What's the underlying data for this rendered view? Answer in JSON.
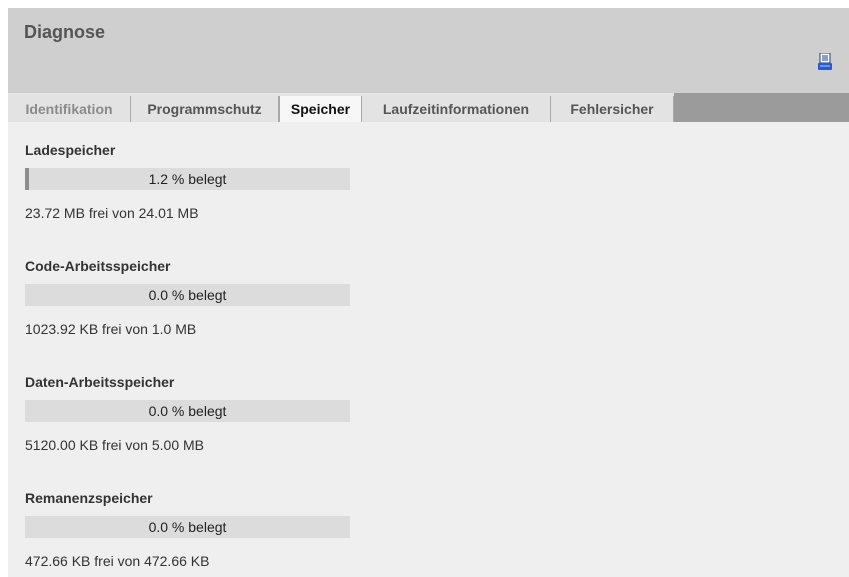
{
  "header": {
    "title": "Diagnose",
    "print_icon": "print-icon"
  },
  "tabs": [
    {
      "label": "Identifikation",
      "active": false
    },
    {
      "label": "Programmschutz",
      "active": false
    },
    {
      "label": "Speicher",
      "active": true
    },
    {
      "label": "Laufzeitinformationen",
      "active": false
    },
    {
      "label": "Fehlersicher",
      "active": false
    }
  ],
  "memory": [
    {
      "name": "Ladespeicher",
      "usage_percent": 1.2,
      "usage_text": "1.2 % belegt",
      "free_text": "23.72 MB frei von 24.01 MB"
    },
    {
      "name": "Code-Arbeitsspeicher",
      "usage_percent": 0.0,
      "usage_text": "0.0 % belegt",
      "free_text": "1023.92 KB frei von 1.0 MB"
    },
    {
      "name": "Daten-Arbeitsspeicher",
      "usage_percent": 0.0,
      "usage_text": "0.0 % belegt",
      "free_text": "5120.00 KB frei von 5.00 MB"
    },
    {
      "name": "Remanenzspeicher",
      "usage_percent": 0.0,
      "usage_text": "0.0 % belegt",
      "free_text": "472.66 KB frei von 472.66 KB"
    }
  ]
}
